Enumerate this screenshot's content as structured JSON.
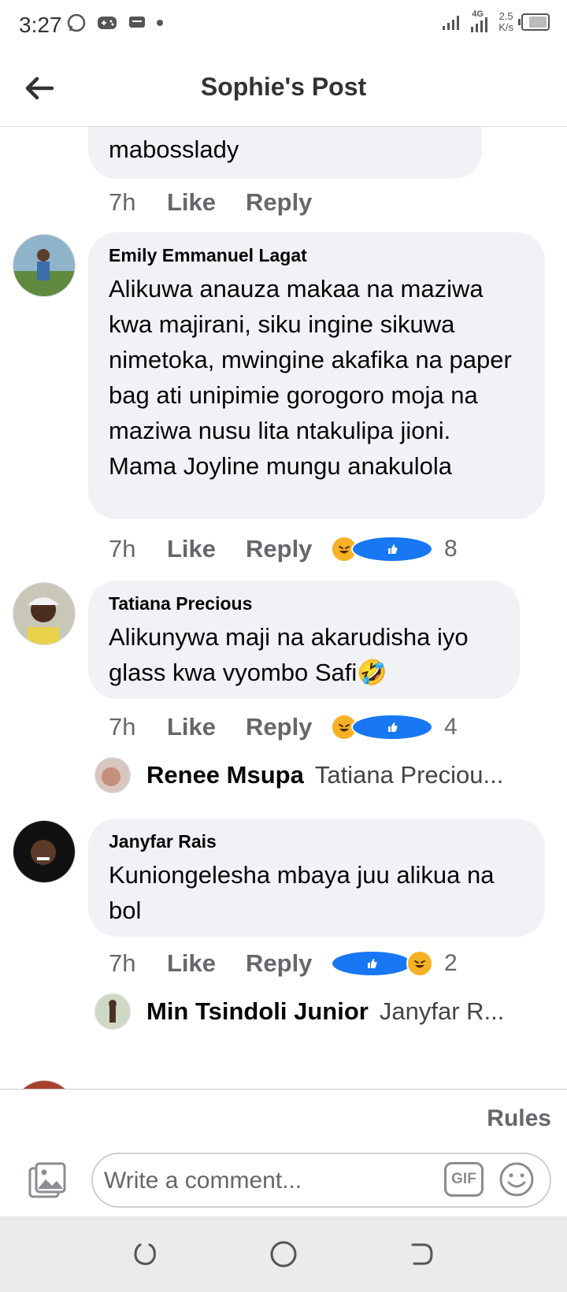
{
  "status_bar": {
    "time": "3:27",
    "network": "4G",
    "speed_value": "2.5",
    "speed_unit": "K/s"
  },
  "header": {
    "title": "Sophie's Post"
  },
  "comments": [
    {
      "text": "mabosslady",
      "time": "7h",
      "like_label": "Like",
      "reply_label": "Reply"
    },
    {
      "author": "Emily Emmanuel Lagat",
      "text": "Alikuwa anauza makaa na maziwa kwa majirani, siku ingine sikuwa nimetoka, mwingine akafika na paper bag ati unipimie gorogoro moja na maziwa nusu lita ntakulipa jioni. Mama Joyline mungu anakulola",
      "time": "7h",
      "like_label": "Like",
      "reply_label": "Reply",
      "reactions": [
        "haha",
        "like"
      ],
      "reaction_count": "8"
    },
    {
      "author": "Tatiana Precious",
      "text": "Alikunywa maji na akarudisha iyo glass kwa vyombo Safi🤣",
      "time": "7h",
      "like_label": "Like",
      "reply_label": "Reply",
      "reactions": [
        "haha",
        "like"
      ],
      "reaction_count": "4",
      "reply_preview": {
        "author": "Renee Msupa",
        "snippet": "Tatiana Preciou..."
      }
    },
    {
      "author": "Janyfar Rais",
      "text": "Kuniongelesha mbaya juu alikua na bol",
      "time": "7h",
      "like_label": "Like",
      "reply_label": "Reply",
      "reactions": [
        "like",
        "haha"
      ],
      "reaction_count": "2",
      "reply_preview": {
        "author": "Min Tsindoli Junior",
        "snippet": "Janyfar R..."
      }
    }
  ],
  "composer": {
    "rules_label": "Rules",
    "placeholder": "Write a comment...",
    "gif_label": "GIF"
  },
  "icons": {
    "back": "arrow-left-icon",
    "photo": "photo-icon",
    "emoji": "smiley-icon",
    "nav": [
      "recent-apps-icon",
      "home-icon",
      "back-nav-icon"
    ]
  },
  "colors": {
    "bubble": "#f0f2f5",
    "muted_text": "#65676b",
    "like_blue": "#1877f2",
    "haha_yellow": "#f7b125"
  }
}
